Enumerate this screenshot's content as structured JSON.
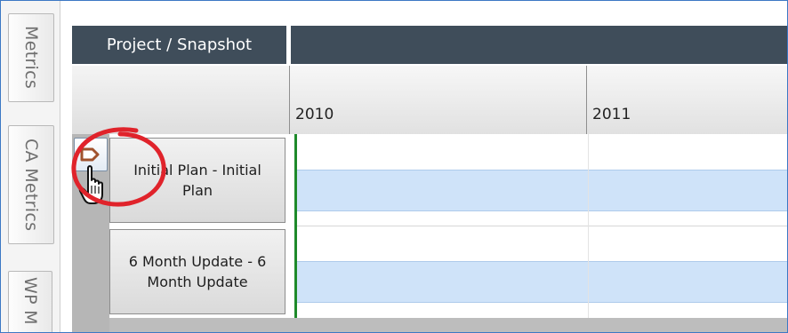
{
  "side_tabs": [
    {
      "label": "Metrics"
    },
    {
      "label": "CA Metrics"
    },
    {
      "label": "WP M"
    }
  ],
  "header": {
    "title": "Project / Snapshot"
  },
  "timeline": {
    "years": [
      "2010",
      "2011"
    ]
  },
  "rows": [
    {
      "label": "Initial Plan - Initial Plan"
    },
    {
      "label": "6 Month Update - 6 Month Update"
    }
  ],
  "colors": {
    "header_bg": "#3f4d5a",
    "bar_fill": "#cfe3f9",
    "today_line": "#1e8a2a",
    "annotation": "#e0232b"
  },
  "icons": {
    "expand": "expand-arrow-icon",
    "cursor": "hand-pointer-icon"
  }
}
